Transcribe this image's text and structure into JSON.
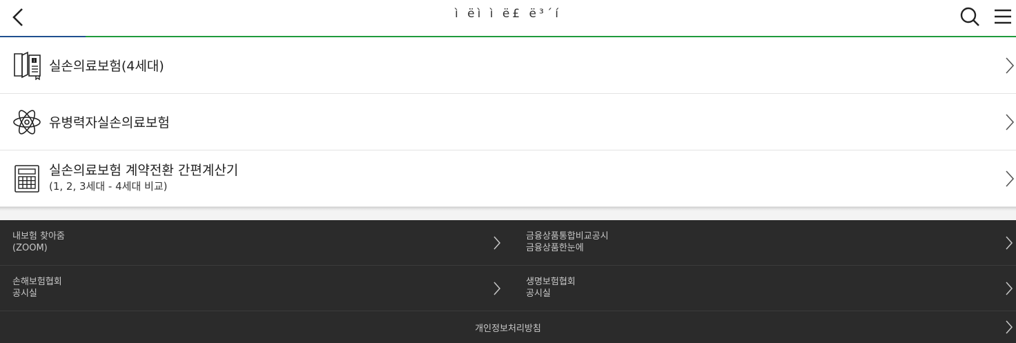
{
  "header": {
    "title": "ì   ëì     ì      ë£   ë³´í",
    "back_icon": "chevron-left-icon",
    "search_icon": "search-icon",
    "menu_icon": "hamburger-menu-icon",
    "progress_fraction": 0.084,
    "colors": {
      "progress_primary": "#1f4f8f",
      "progress_track": "#1f9a3c"
    }
  },
  "list": {
    "items": [
      {
        "label": "실손의료보험(4세대)",
        "icon": "booklet-info-icon"
      },
      {
        "label": "유병력자실손의료보험",
        "icon": "atom-icon"
      },
      {
        "label": "실손의료보험 계약전환 간편계산기",
        "sublabel": "(1, 2, 3세대 - 4세대 비교)",
        "icon": "calculator-icon"
      }
    ]
  },
  "footer": {
    "links": [
      {
        "line1": "내보험 찾아줌",
        "line2": "(ZOOM)"
      },
      {
        "line1": "금융상품통합비교공시",
        "line2": "금융상품한눈에"
      },
      {
        "line1": "손해보험협회",
        "line2": "공시실"
      },
      {
        "line1": "생명보험협회",
        "line2": "공시실"
      }
    ],
    "privacy": "개인정보처리방침",
    "colors": {
      "background": "#2b2b2b",
      "text": "#c8c8c8"
    }
  }
}
